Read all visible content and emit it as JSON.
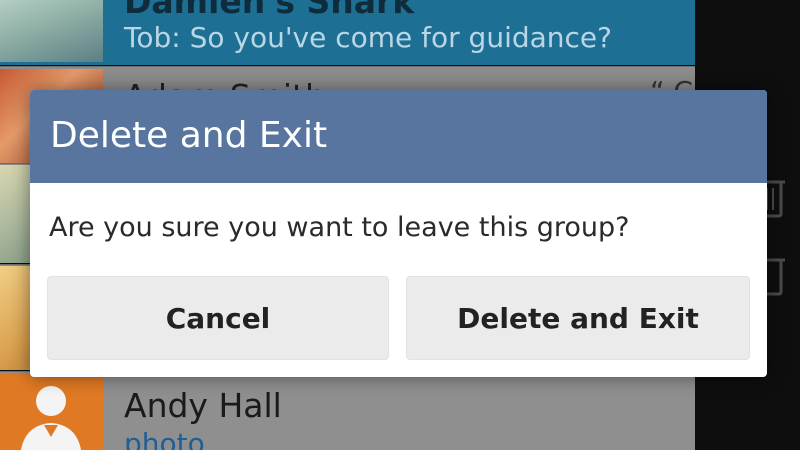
{
  "background": {
    "chats": [
      {
        "name": "Damien's Shark",
        "preview": "Tob: So you've come for guidance?"
      },
      {
        "name": "Adam Smith",
        "preview": "",
        "tail": "“ C"
      },
      {
        "name": "",
        "preview": ""
      },
      {
        "name": "",
        "preview": ""
      },
      {
        "name": "Andy Hall",
        "preview": "photo"
      }
    ],
    "side_icons": [
      "trash-icon",
      "trash-icon"
    ]
  },
  "dialog": {
    "title": "Delete and Exit",
    "message": "Are you sure you want to leave this group?",
    "cancel_label": "Cancel",
    "confirm_label": "Delete and Exit"
  },
  "colors": {
    "header": "#57759f",
    "button_bg": "#ebebeb",
    "highlight_row": "#1d6f93",
    "link": "#1f5e96"
  }
}
